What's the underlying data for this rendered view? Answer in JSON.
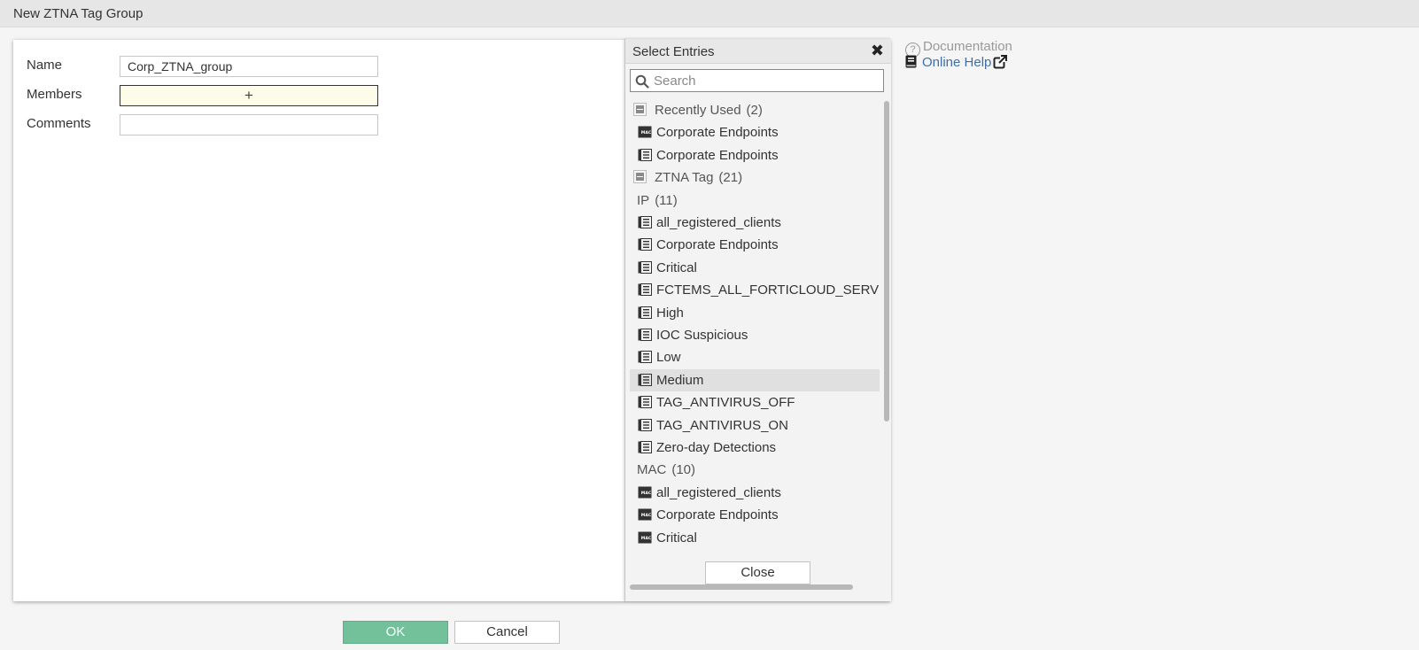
{
  "window": {
    "title": "New ZTNA Tag Group"
  },
  "form": {
    "name_label": "Name",
    "name_value": "Corp_ZTNA_group",
    "members_label": "Members",
    "members_add": "+",
    "comments_label": "Comments",
    "comments_value": ""
  },
  "popup": {
    "title": "Select Entries",
    "close_glyph": "✖",
    "search_placeholder": "Search",
    "close_button": "Close",
    "rows": [
      {
        "type": "group",
        "label": "Recently Used",
        "count": "(2)"
      },
      {
        "type": "entry",
        "icon": "mac-tag-icon",
        "label": "Corporate Endpoints"
      },
      {
        "type": "entry",
        "icon": "ip-tag-icon",
        "label": "Corporate Endpoints"
      },
      {
        "type": "group",
        "label": "ZTNA Tag",
        "count": "(21)"
      },
      {
        "type": "subgroup",
        "label": "IP",
        "count": "(11)"
      },
      {
        "type": "entry",
        "icon": "ip-tag-icon",
        "label": "all_registered_clients"
      },
      {
        "type": "entry",
        "icon": "ip-tag-icon",
        "label": "Corporate Endpoints"
      },
      {
        "type": "entry",
        "icon": "ip-tag-icon",
        "label": "Critical"
      },
      {
        "type": "entry",
        "icon": "ip-tag-icon",
        "label": "FCTEMS_ALL_FORTICLOUD_SERVERS"
      },
      {
        "type": "entry",
        "icon": "ip-tag-icon",
        "label": "High"
      },
      {
        "type": "entry",
        "icon": "ip-tag-icon",
        "label": "IOC Suspicious"
      },
      {
        "type": "entry",
        "icon": "ip-tag-icon",
        "label": "Low"
      },
      {
        "type": "entry",
        "icon": "ip-tag-icon",
        "label": "Medium",
        "selected": true
      },
      {
        "type": "entry",
        "icon": "ip-tag-icon",
        "label": "TAG_ANTIVIRUS_OFF"
      },
      {
        "type": "entry",
        "icon": "ip-tag-icon",
        "label": "TAG_ANTIVIRUS_ON"
      },
      {
        "type": "entry",
        "icon": "ip-tag-icon",
        "label": "Zero-day Detections"
      },
      {
        "type": "subgroup",
        "label": "MAC",
        "count": "(10)"
      },
      {
        "type": "entry",
        "icon": "mac-tag-icon",
        "label": "all_registered_clients"
      },
      {
        "type": "entry",
        "icon": "mac-tag-icon",
        "label": "Corporate Endpoints"
      },
      {
        "type": "entry",
        "icon": "mac-tag-icon",
        "label": "Critical"
      }
    ]
  },
  "help": {
    "documentation": "Documentation",
    "online_help": "Online Help"
  },
  "buttons": {
    "ok": "OK",
    "cancel": "Cancel"
  },
  "colors": {
    "accent_ok": "#72c19a",
    "link": "#3f6fa8",
    "selected_row": "#e0e0e0"
  }
}
